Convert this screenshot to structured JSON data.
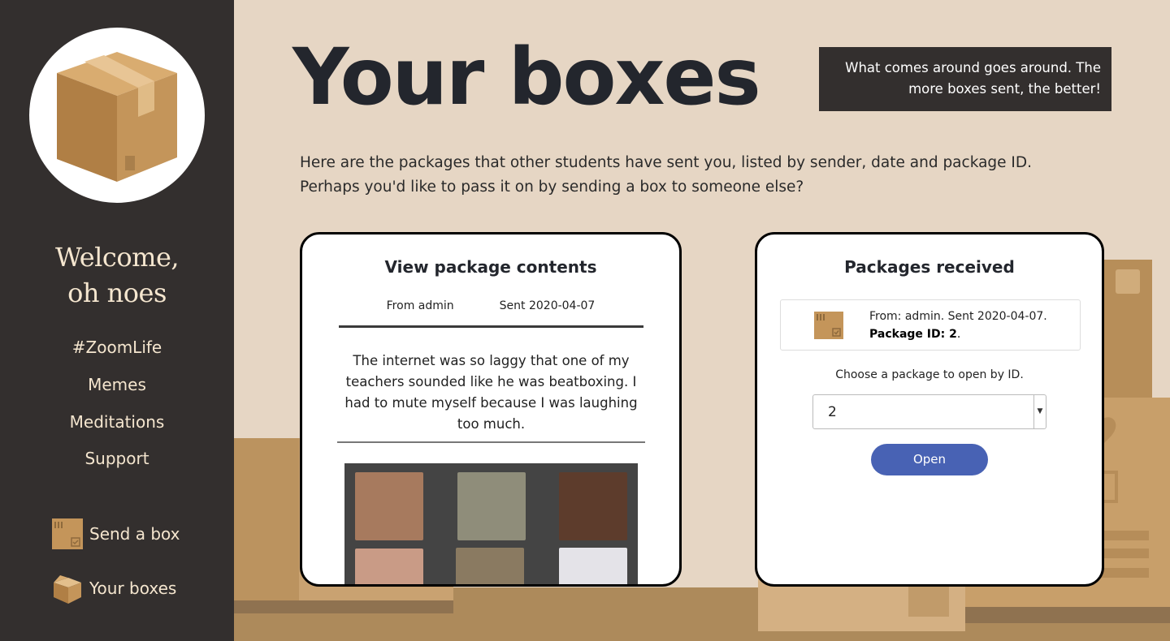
{
  "sidebar": {
    "logo_icon": "cardboard-box-icon",
    "welcome_line1": "Welcome,",
    "welcome_line2": "oh noes",
    "nav": [
      "#ZoomLife",
      "Memes",
      "Meditations",
      "Support"
    ],
    "send_box": {
      "icon": "box-checked-icon",
      "label": "Send a box"
    },
    "your_boxes": {
      "icon": "open-box-icon",
      "label": "Your boxes"
    }
  },
  "header": {
    "title": "Your boxes",
    "tagline": "What comes around goes around. The more boxes sent, the better!"
  },
  "intro": {
    "line1": "Here are the packages that other students have sent you, listed by sender, date and package ID.",
    "line2": "Perhaps you'd like to pass it on by sending a box to someone else?"
  },
  "view_package": {
    "title": "View package contents",
    "from": "From admin",
    "sent": "Sent 2020-04-07",
    "message": "The internet was so laggy that one of my teachers sounded like he was beatboxing. I had to mute myself because I was laughing too much.",
    "image_icon": "video-call-grid-meme-image"
  },
  "packages": {
    "title": "Packages received",
    "list": [
      {
        "line1": "From: admin. Sent 2020-04-07.",
        "id_label": "Package ID: 2",
        "suffix": "."
      }
    ],
    "choose_label": "Choose a package to open by ID.",
    "selected_id": "2",
    "open_label": "Open"
  },
  "colors": {
    "sidebar_bg": "#332f2e",
    "page_bg": "#e6d6c4",
    "accent_button": "#4862b4",
    "box_brown": "#c4955a"
  }
}
